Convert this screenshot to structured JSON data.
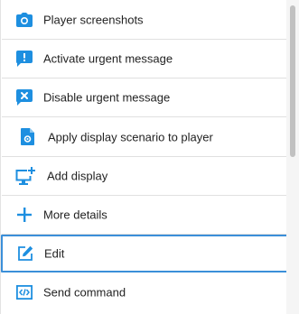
{
  "menu": {
    "items": [
      {
        "label": "Player screenshots",
        "icon": "camera-icon"
      },
      {
        "label": "Activate urgent message",
        "icon": "urgent-message-icon"
      },
      {
        "label": "Disable urgent message",
        "icon": "disable-message-icon"
      },
      {
        "label": "Apply display scenario to player",
        "icon": "scenario-file-icon"
      },
      {
        "label": "Add display",
        "icon": "add-display-icon"
      },
      {
        "label": "More details",
        "icon": "plus-icon"
      },
      {
        "label": "Edit",
        "icon": "edit-icon"
      },
      {
        "label": "Send command",
        "icon": "code-icon"
      }
    ],
    "selected_index": 6
  },
  "colors": {
    "icon": "#1e8fe0",
    "selected_border": "#3b8fd9",
    "divider": "#e0e0e0",
    "text": "#222222"
  }
}
